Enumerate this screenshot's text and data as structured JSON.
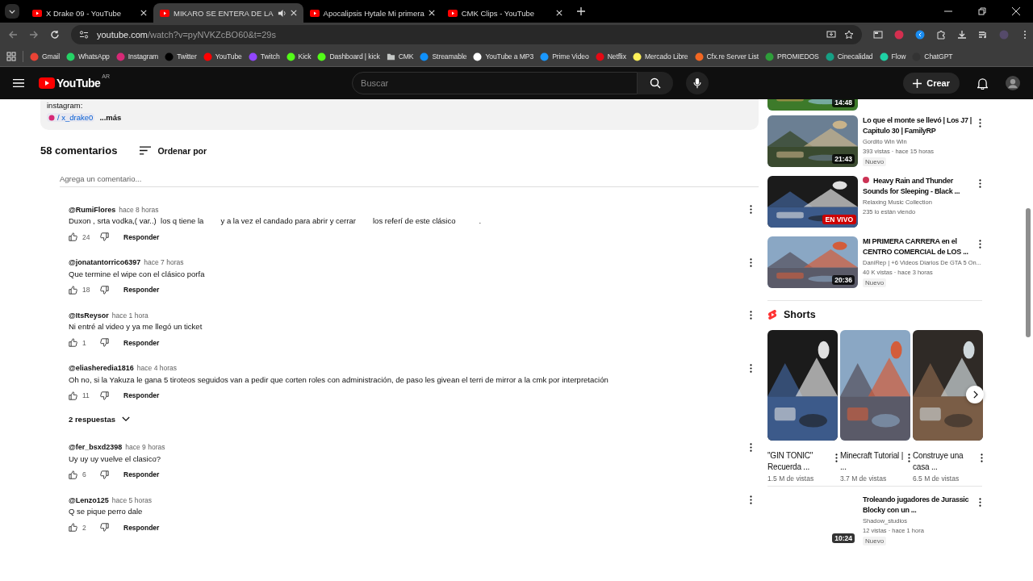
{
  "browser": {
    "tabs": [
      {
        "title": "X Drake 09 - YouTube",
        "selected": false,
        "audio": false
      },
      {
        "title": "MIKARO SE ENTERA DE LA",
        "selected": true,
        "audio": true
      },
      {
        "title": "Apocalipsis Hytale Mi primera",
        "selected": false,
        "audio": false
      },
      {
        "title": "CMK Clips - YouTube",
        "selected": false,
        "audio": false
      }
    ],
    "url_host": "youtube.com",
    "url_path": "/watch?v=pyNVKZcBO60&t=29s",
    "bookmarks": [
      {
        "label": "Gmail",
        "kind": "site",
        "color": "#ea4335"
      },
      {
        "label": "WhatsApp",
        "kind": "site",
        "color": "#25d366"
      },
      {
        "label": "Instagram",
        "kind": "site",
        "color": "#d62976"
      },
      {
        "label": "Twitter",
        "kind": "site",
        "color": "#000000"
      },
      {
        "label": "YouTube",
        "kind": "site",
        "color": "#ff0000"
      },
      {
        "label": "Twitch",
        "kind": "site",
        "color": "#9146ff"
      },
      {
        "label": "Kick",
        "kind": "site",
        "color": "#53fc18"
      },
      {
        "label": "Dashboard | kick",
        "kind": "site",
        "color": "#53fc18"
      },
      {
        "label": "CMK",
        "kind": "folder",
        "color": "#c4c7c5"
      },
      {
        "label": "Streamable",
        "kind": "site",
        "color": "#0f90fa"
      },
      {
        "label": "YouTube a MP3",
        "kind": "site",
        "color": "#ffffff"
      },
      {
        "label": "Prime Video",
        "kind": "site",
        "color": "#1a98ff"
      },
      {
        "label": "Netflix",
        "kind": "site",
        "color": "#e50914"
      },
      {
        "label": "Mercado Libre",
        "kind": "site",
        "color": "#fff159"
      },
      {
        "label": "Cfx.re Server List",
        "kind": "site",
        "color": "#f26722"
      },
      {
        "label": "PROMIEDOS",
        "kind": "site",
        "color": "#2e9e3a"
      },
      {
        "label": "Cinecalidad",
        "kind": "site",
        "color": "#16a085"
      },
      {
        "label": "Flow",
        "kind": "site",
        "color": "#1fd1a5"
      },
      {
        "label": "ChatGPT",
        "kind": "site",
        "color": "#333333"
      }
    ]
  },
  "youtube": {
    "logo": "YouTube",
    "region": "AR",
    "search_placeholder": "Buscar",
    "create": "Crear"
  },
  "description": {
    "label": "instagram:",
    "link": "/ x_drake0",
    "more": "...más"
  },
  "comments": {
    "count": "58 comentarios",
    "sort": "Ordenar por",
    "add_placeholder": "Agrega un comentario...",
    "items": [
      {
        "author": "@RumiFlores",
        "time": "hace 8 horas",
        "text": "Duxon , srta vodka,( var..)  los q tiene la        y a la vez el candado para abrir y cerrar        los referí de este clásico           .",
        "likes": "24",
        "reply": "Responder"
      },
      {
        "author": "@jonatantorrico6397",
        "time": "hace 7 horas",
        "text": "Que termine el wipe con el clásico porfa",
        "likes": "18",
        "reply": "Responder"
      },
      {
        "author": "@ItsReysor",
        "time": "hace 1 hora",
        "text": "Ni entré al video y ya me llegó un ticket",
        "likes": "1",
        "reply": "Responder"
      },
      {
        "author": "@eliasheredia1816",
        "time": "hace 4 horas",
        "text": "Oh no, si la Yakuza le gana 5 tiroteos seguidos van a pedir que corten roles con administración, de paso les givean el terri de mirror a la cmk por interpretación",
        "likes": "11",
        "reply": "Responder",
        "replies": "2 respuestas"
      },
      {
        "author": "@fer_bsxd2398",
        "time": "hace 9 horas",
        "text": "Uy uy uy vuelve el clasico?",
        "likes": "6",
        "reply": "Responder"
      },
      {
        "author": "@Lenzo125",
        "time": "hace 5 horas",
        "text": "Q se pique perro dale",
        "likes": "2",
        "reply": "Responder"
      }
    ]
  },
  "partial_video": {
    "duration": "14:48"
  },
  "videos": [
    {
      "duration": "21:43",
      "title": "Lo que el monte se llevó | Los J7 | Capitulo 30 | FamilyRP",
      "channel": "Gordito Win Win",
      "meta": "393 vistas · hace 15 horas",
      "badge": "Nuevo",
      "live": false
    },
    {
      "title": "Heavy Rain and Thunder Sounds for Sleeping - Black ...",
      "channel": "Relaxing Music Collection",
      "meta": "235 lo están viendo",
      "live": true,
      "live_label": "EN VIVO"
    },
    {
      "duration": "20:36",
      "title": "MI PRIMERA CARRERA en el CENTRO COMERCIAL de LOS ...",
      "channel": "DaniRep | +6 Videos Diarios De GTA 5 On...",
      "meta": "40 K vistas · hace 3 horas",
      "badge": "Nuevo",
      "live": false
    }
  ],
  "shorts": {
    "title": "Shorts",
    "items": [
      {
        "title": "\"GIN TONIC\" Recuerda ...",
        "views": "1.5 M de vistas"
      },
      {
        "title": "Minecraft Tutorial | ...",
        "views": "3.7 M de vistas"
      },
      {
        "title": "Construye una casa ...",
        "views": "6.5 M de vistas"
      }
    ]
  },
  "more_videos": [
    {
      "duration": "10:24",
      "title": "Troleando jugadores de Jurassic Blocky con un ...",
      "channel": "Shadow_studios",
      "meta": "12 vistas · hace 1 hora",
      "badge": "Nuevo",
      "live": false
    }
  ]
}
